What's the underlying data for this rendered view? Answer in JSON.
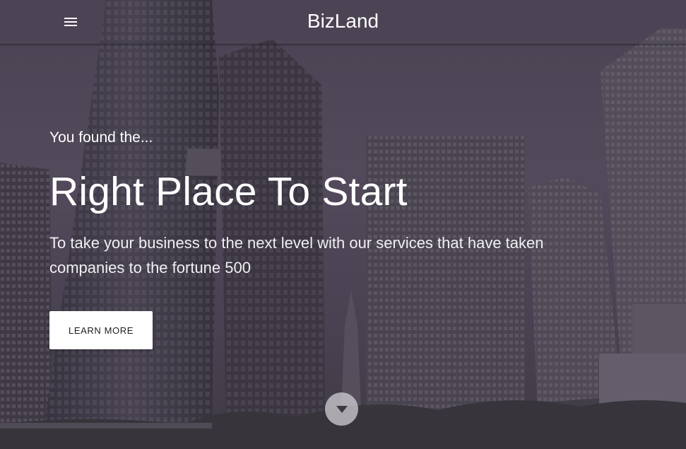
{
  "navbar": {
    "menu_icon": "hamburger-menu-icon",
    "brand": "BizLand"
  },
  "hero": {
    "kicker": "You found the...",
    "headline": "Right Place To Start",
    "lead": "To take your business to the next level with our services that have taken companies to the fortune 500",
    "cta_label": "LEARN MORE",
    "scroll_icon": "caret-down-icon",
    "background_image": "city-skyline-buildings"
  },
  "colors": {
    "text": "#ffffff",
    "overlay": "#463c50",
    "button_bg": "#ffffff",
    "button_text": "#1e1e1e"
  }
}
